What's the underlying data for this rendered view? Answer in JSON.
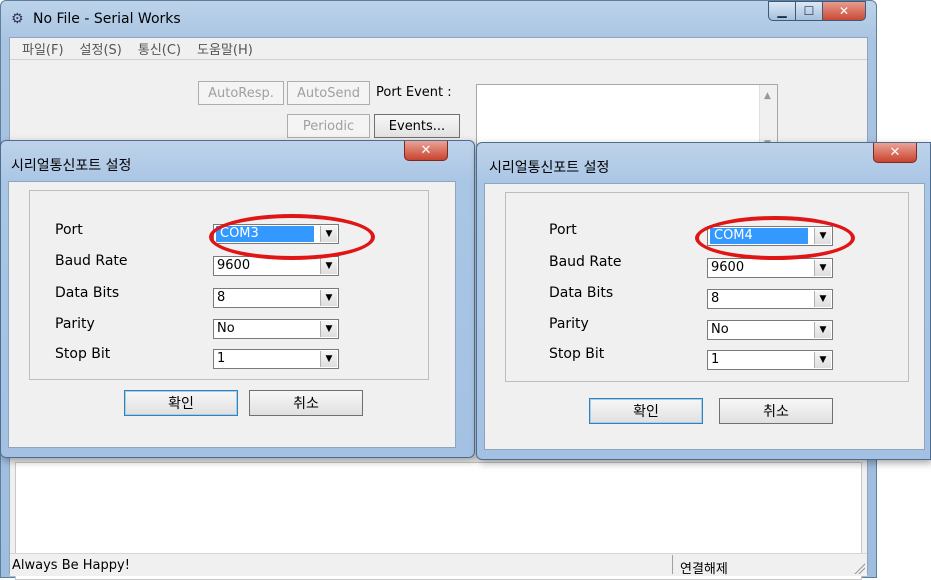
{
  "main_window": {
    "title": "No File - Serial Works",
    "menu": [
      "파일(F)",
      "설정(S)",
      "통신(C)",
      "도움말(H)"
    ],
    "toolbar": {
      "autoresp_label": "AutoResp.",
      "autosend_label": "AutoSend",
      "periodic_label": "Periodic",
      "events_label": "Events...",
      "port_event_label": "Port Event :"
    },
    "status": {
      "left_text": "Always Be Happy!",
      "right_text": "연결해제"
    }
  },
  "dialog_left": {
    "title": "시리얼통신포트 설정",
    "fields": [
      {
        "label": "Port",
        "value": "COM3"
      },
      {
        "label": "Baud Rate",
        "value": "9600"
      },
      {
        "label": "Data Bits",
        "value": "8"
      },
      {
        "label": "Parity",
        "value": "No"
      },
      {
        "label": "Stop Bit",
        "value": "1"
      }
    ],
    "ok_label": "확인",
    "cancel_label": "취소"
  },
  "dialog_right": {
    "title": "시리얼통신포트 설정",
    "fields": [
      {
        "label": "Port",
        "value": "COM4"
      },
      {
        "label": "Baud Rate",
        "value": "9600"
      },
      {
        "label": "Data Bits",
        "value": "8"
      },
      {
        "label": "Parity",
        "value": "No"
      },
      {
        "label": "Stop Bit",
        "value": "1"
      }
    ],
    "ok_label": "확인",
    "cancel_label": "취소"
  },
  "icons": {
    "app": "serial-works-app-icon",
    "minimize": "minimize-icon",
    "maximize": "maximize-icon",
    "close": "close-icon",
    "dropdown": "chevron-down-icon"
  },
  "colors": {
    "highlight_ring": "#e01515",
    "selection": "#3399ff",
    "close_button": "#c8442f"
  }
}
